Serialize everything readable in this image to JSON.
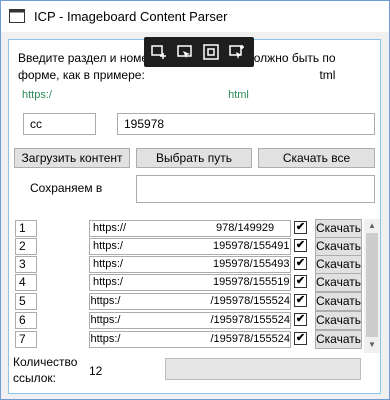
{
  "window": {
    "title": "ICP - Imageboard Content Parser"
  },
  "info": {
    "line1": "Введите раздел и номе",
    "line1b": "должно быть по",
    "line2": "форме, как в примере:",
    "line2b": "tml",
    "example_link_a": "https:/",
    "example_link_b": "html"
  },
  "inputs": {
    "board_value": "cc",
    "thread_value": "195978",
    "save_path_value": ""
  },
  "buttons": {
    "load_content": "Загрузить контент",
    "choose_path": "Выбрать путь",
    "download_all": "Скачать все"
  },
  "save_label": "Сохраняем в",
  "rows": [
    {
      "num": "1",
      "url": "https://",
      "url_tail": "978/149929",
      "checked": "✔",
      "button": "Скачать"
    },
    {
      "num": "2",
      "url": "https:/",
      "url_tail": "195978/155491",
      "checked": "✔",
      "button": "Скачать"
    },
    {
      "num": "3",
      "url": "https:/",
      "url_tail": "195978/155493",
      "checked": "✔",
      "button": "Скачать"
    },
    {
      "num": "4",
      "url": "https:/",
      "url_tail": "195978/155519",
      "checked": "✔",
      "button": "Скачать"
    },
    {
      "num": "5",
      "url": "https:/",
      "url_tail": "/195978/155524",
      "checked": "✔",
      "button": "Скачать"
    },
    {
      "num": "6",
      "url": "https:/",
      "url_tail": "/195978/155524",
      "checked": "✔",
      "button": "Скачать"
    },
    {
      "num": "7",
      "url": "https:/",
      "url_tail": "/195978/155524",
      "checked": "✔",
      "button": "Скачать"
    }
  ],
  "footer": {
    "count_label_1": "Количество",
    "count_label_2": "ссылок:",
    "count_value": "12"
  },
  "icons": {
    "app": "app-icon",
    "toolbar": [
      "add-window-icon",
      "cursor-window-icon",
      "fullscreen-icon",
      "cursor-capture-icon"
    ]
  },
  "colors": {
    "accent_border": "#6f9ad3",
    "link_green": "#2e8b57",
    "button_bg": "#e1e1e1"
  }
}
